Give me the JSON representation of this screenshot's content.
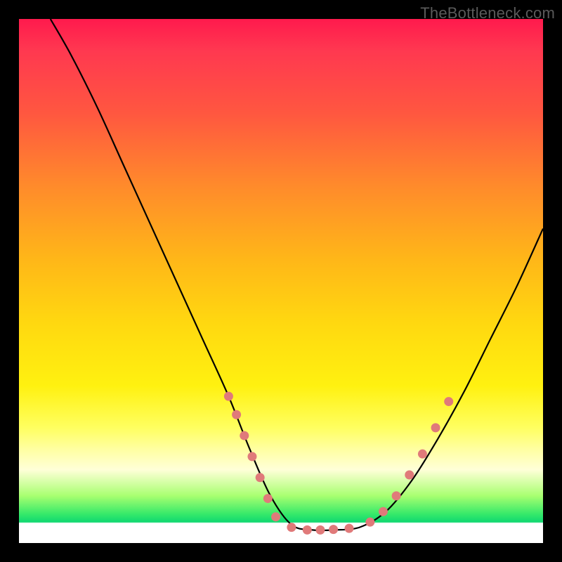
{
  "watermark": "TheBottleneck.com",
  "chart_data": {
    "type": "line",
    "title": "",
    "xlabel": "",
    "ylabel": "",
    "xlim": [
      0,
      100
    ],
    "ylim": [
      0,
      100
    ],
    "grid": false,
    "legend": false,
    "series": [
      {
        "name": "bottleneck-curve",
        "x": [
          6,
          10,
          15,
          20,
          25,
          30,
          35,
          40,
          44,
          48,
          52,
          56,
          60,
          65,
          70,
          75,
          80,
          85,
          90,
          95,
          100
        ],
        "y": [
          100,
          93,
          83,
          72,
          61,
          50,
          39,
          28,
          18,
          9,
          3.5,
          2.5,
          2.5,
          3,
          6,
          12,
          20,
          29,
          39,
          49,
          60
        ]
      }
    ],
    "markers": {
      "name": "highlight-dots",
      "points": [
        {
          "x": 40,
          "y": 28
        },
        {
          "x": 41.5,
          "y": 24.5
        },
        {
          "x": 43,
          "y": 20.5
        },
        {
          "x": 44.5,
          "y": 16.5
        },
        {
          "x": 46,
          "y": 12.5
        },
        {
          "x": 47.5,
          "y": 8.5
        },
        {
          "x": 49,
          "y": 5
        },
        {
          "x": 52,
          "y": 3
        },
        {
          "x": 55,
          "y": 2.5
        },
        {
          "x": 57.5,
          "y": 2.5
        },
        {
          "x": 60,
          "y": 2.6
        },
        {
          "x": 63,
          "y": 2.8
        },
        {
          "x": 67,
          "y": 4
        },
        {
          "x": 69.5,
          "y": 6
        },
        {
          "x": 72,
          "y": 9
        },
        {
          "x": 74.5,
          "y": 13
        },
        {
          "x": 77,
          "y": 17
        },
        {
          "x": 79.5,
          "y": 22
        },
        {
          "x": 82,
          "y": 27
        }
      ]
    },
    "background_gradient": {
      "direction": "vertical",
      "stops": [
        {
          "pos": 0.0,
          "color": "#ff1a4d"
        },
        {
          "pos": 0.32,
          "color": "#ff8b2b"
        },
        {
          "pos": 0.58,
          "color": "#ffd810"
        },
        {
          "pos": 0.82,
          "color": "#ffffa0"
        },
        {
          "pos": 0.94,
          "color": "#35e96a"
        },
        {
          "pos": 1.0,
          "color": "#ffffff"
        }
      ]
    }
  }
}
